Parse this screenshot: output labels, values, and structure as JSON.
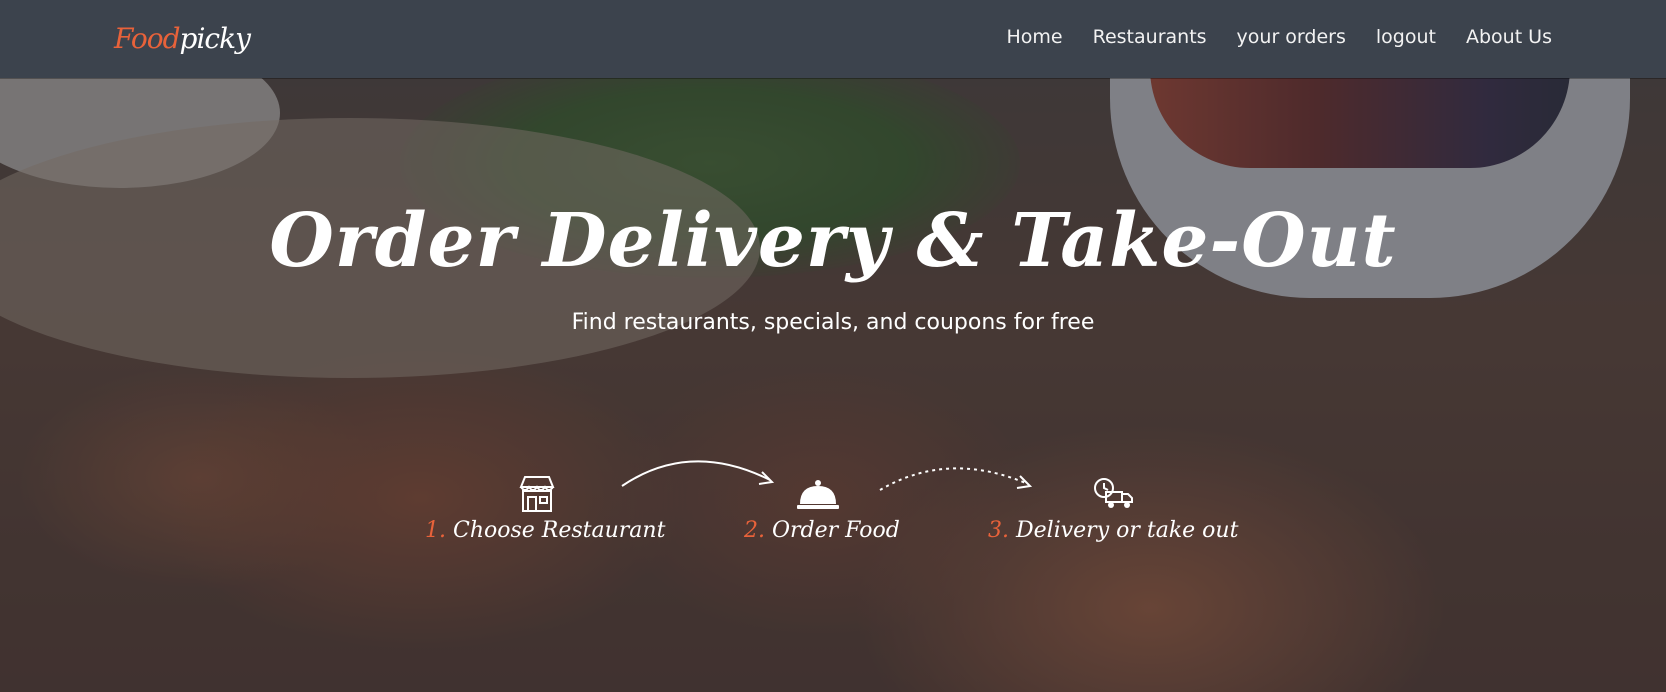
{
  "brand": {
    "logo_part1": "Food",
    "logo_part2": "picky"
  },
  "nav": {
    "items": [
      {
        "label": "Home"
      },
      {
        "label": "Restaurants"
      },
      {
        "label": "your orders"
      },
      {
        "label": "logout"
      },
      {
        "label": "About Us"
      }
    ]
  },
  "hero": {
    "title": "Order Delivery & Take-Out",
    "subtitle": "Find restaurants, specials, and coupons for free",
    "steps": [
      {
        "number": "1.",
        "label": "Choose Restaurant",
        "icon": "storefront-icon"
      },
      {
        "number": "2.",
        "label": "Order Food",
        "icon": "cloche-icon"
      },
      {
        "number": "3.",
        "label": "Delivery or take out",
        "icon": "delivery-truck-icon"
      }
    ]
  },
  "colors": {
    "navbar": "#3c434d",
    "accent": "#e8623a",
    "text": "#ffffff"
  }
}
